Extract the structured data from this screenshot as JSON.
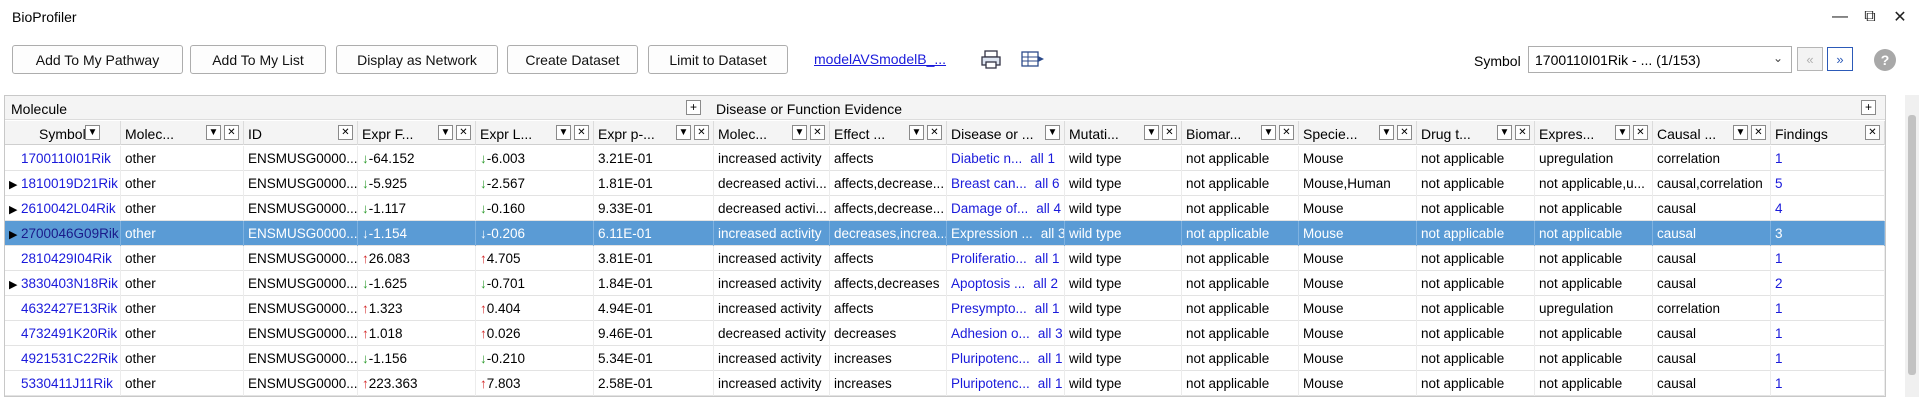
{
  "window": {
    "title": "BioProfiler"
  },
  "toolbar": {
    "add_pathway": "Add To My Pathway",
    "add_list": "Add To My List",
    "display_network": "Display as Network",
    "create_dataset": "Create Dataset",
    "limit_dataset": "Limit to Dataset",
    "dataset_link": "modelAVSmodelB_...",
    "symbol_label": "Symbol",
    "symbol_value": "1700110I01Rik - ... (1/153)"
  },
  "groups": {
    "molecule": "Molecule",
    "disease": "Disease or Function Evidence"
  },
  "columns": [
    "Symbol",
    "Molec...",
    "ID",
    "Expr F...",
    "Expr L...",
    "Expr p-...",
    "Molec...",
    "Effect ...",
    "Disease or ...",
    "Mutati...",
    "Biomar...",
    "Specie...",
    "Drug t...",
    "Expres...",
    "Causal ...",
    "Findings"
  ],
  "rows": [
    {
      "expand": "",
      "symbol": "1700110I01Rik",
      "type": "other",
      "id": "ENSMUSG0000...",
      "fc": "-64.152",
      "fcdir": "down",
      "lr": "-6.003",
      "lrdir": "down",
      "p": "3.21E-01",
      "mol": "increased activity",
      "effect": "affects",
      "disease": "Diabetic n...",
      "all": "all 1",
      "mut": "wild type",
      "bio": "not applicable",
      "species": "Mouse",
      "drug": "not applicable",
      "expr": "upregulation",
      "causal": "correlation",
      "findings": "1"
    },
    {
      "expand": "▶",
      "symbol": "1810019D21Rik",
      "type": "other",
      "id": "ENSMUSG0000...",
      "fc": "-5.925",
      "fcdir": "down",
      "lr": "-2.567",
      "lrdir": "down",
      "p": "1.81E-01",
      "mol": "decreased activi...",
      "effect": "affects,decrease...",
      "disease": "Breast can...",
      "all": "all 6",
      "mut": "wild type",
      "bio": "not applicable",
      "species": "Mouse,Human",
      "drug": "not applicable",
      "expr": "not applicable,u...",
      "causal": "causal,correlation",
      "findings": "5"
    },
    {
      "expand": "▶",
      "symbol": "2610042L04Rik",
      "type": "other",
      "id": "ENSMUSG0000...",
      "fc": "-1.117",
      "fcdir": "down",
      "lr": "-0.160",
      "lrdir": "down",
      "p": "9.33E-01",
      "mol": "decreased activi...",
      "effect": "affects,decrease...",
      "disease": "Damage of...",
      "all": "all 4",
      "mut": "wild type",
      "bio": "not applicable",
      "species": "Mouse",
      "drug": "not applicable",
      "expr": "not applicable",
      "causal": "causal",
      "findings": "4"
    },
    {
      "expand": "▶",
      "symbol": "2700046G09Rik",
      "type": "other",
      "id": "ENSMUSG0000...",
      "fc": "-1.154",
      "fcdir": "down",
      "lr": "-0.206",
      "lrdir": "down",
      "p": "6.11E-01",
      "mol": "increased activity",
      "effect": "decreases,increa...",
      "disease": "Expression ...",
      "all": "all 3",
      "mut": "wild type",
      "bio": "not applicable",
      "species": "Mouse",
      "drug": "not applicable",
      "expr": "not applicable",
      "causal": "causal",
      "findings": "3",
      "selected": true
    },
    {
      "expand": "",
      "symbol": "2810429I04Rik",
      "type": "other",
      "id": "ENSMUSG0000...",
      "fc": "26.083",
      "fcdir": "up",
      "lr": "4.705",
      "lrdir": "up",
      "p": "3.81E-01",
      "mol": "increased activity",
      "effect": "affects",
      "disease": "Proliferatio...",
      "all": "all 1",
      "mut": "wild type",
      "bio": "not applicable",
      "species": "Mouse",
      "drug": "not applicable",
      "expr": "not applicable",
      "causal": "causal",
      "findings": "1"
    },
    {
      "expand": "▶",
      "symbol": "3830403N18Rik",
      "type": "other",
      "id": "ENSMUSG0000...",
      "fc": "-1.625",
      "fcdir": "down",
      "lr": "-0.701",
      "lrdir": "down",
      "p": "1.84E-01",
      "mol": "increased activity",
      "effect": "affects,decreases",
      "disease": "Apoptosis ...",
      "all": "all 2",
      "mut": "wild type",
      "bio": "not applicable",
      "species": "Mouse",
      "drug": "not applicable",
      "expr": "not applicable",
      "causal": "causal",
      "findings": "2"
    },
    {
      "expand": "",
      "symbol": "4632427E13Rik",
      "type": "other",
      "id": "ENSMUSG0000...",
      "fc": "1.323",
      "fcdir": "up",
      "lr": "0.404",
      "lrdir": "up",
      "p": "4.94E-01",
      "mol": "increased activity",
      "effect": "affects",
      "disease": "Presympto...",
      "all": "all 1",
      "mut": "wild type",
      "bio": "not applicable",
      "species": "Mouse",
      "drug": "not applicable",
      "expr": "upregulation",
      "causal": "correlation",
      "findings": "1"
    },
    {
      "expand": "",
      "symbol": "4732491K20Rik",
      "type": "other",
      "id": "ENSMUSG0000...",
      "fc": "1.018",
      "fcdir": "up",
      "lr": "0.026",
      "lrdir": "up",
      "p": "9.46E-01",
      "mol": "decreased activity",
      "effect": "decreases",
      "disease": "Adhesion o...",
      "all": "all 3",
      "mut": "wild type",
      "bio": "not applicable",
      "species": "Mouse",
      "drug": "not applicable",
      "expr": "not applicable",
      "causal": "causal",
      "findings": "1"
    },
    {
      "expand": "",
      "symbol": "4921531C22Rik",
      "type": "other",
      "id": "ENSMUSG0000...",
      "fc": "-1.156",
      "fcdir": "down",
      "lr": "-0.210",
      "lrdir": "down",
      "p": "5.34E-01",
      "mol": "increased activity",
      "effect": "increases",
      "disease": "Pluripotenc...",
      "all": "all 1",
      "mut": "wild type",
      "bio": "not applicable",
      "species": "Mouse",
      "drug": "not applicable",
      "expr": "not applicable",
      "causal": "causal",
      "findings": "1"
    },
    {
      "expand": "",
      "symbol": "5330411J11Rik",
      "type": "other",
      "id": "ENSMUSG0000...",
      "fc": "223.363",
      "fcdir": "up",
      "lr": "7.803",
      "lrdir": "up",
      "p": "2.58E-01",
      "mol": "increased activity",
      "effect": "increases",
      "disease": "Pluripotenc...",
      "all": "all 1",
      "mut": "wild type",
      "bio": "not applicable",
      "species": "Mouse",
      "drug": "not applicable",
      "expr": "not applicable",
      "causal": "causal",
      "findings": "1"
    }
  ]
}
